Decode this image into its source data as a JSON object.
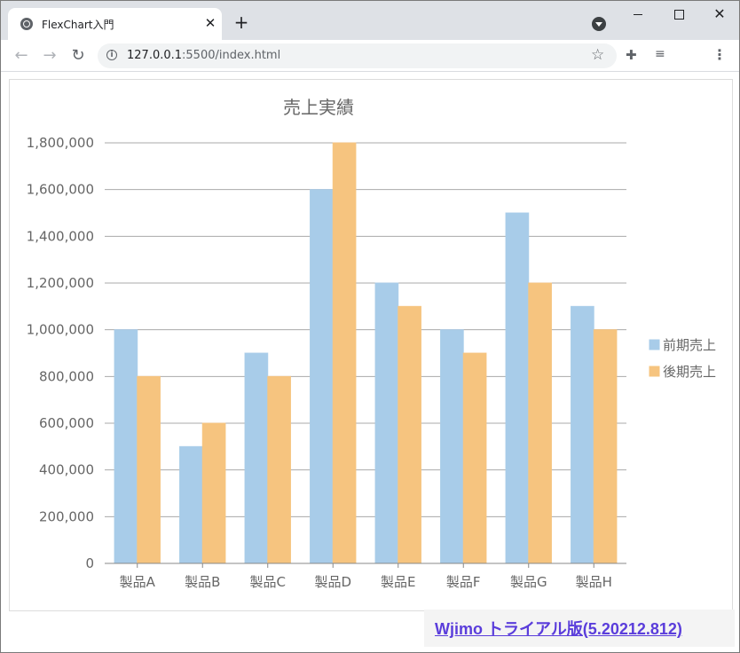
{
  "browser": {
    "tab_title": "FlexChart入門",
    "tab_close": "✕",
    "new_tab": "+",
    "url_host": "127.0.0.1",
    "url_rest": ":5500/index.html",
    "icons": [
      "globe-icon",
      "close-icon",
      "plus-icon",
      "tab-search-icon",
      "minimize-icon",
      "maximize-icon",
      "window-close-icon",
      "back-icon",
      "forward-icon",
      "reload-icon",
      "info-icon",
      "star-icon",
      "extensions-icon",
      "media-icon",
      "menu-icon"
    ]
  },
  "trial_link": "Wjimo トライアル版(5.20212.812)",
  "chart_data": {
    "type": "bar",
    "title": "売上実績",
    "categories": [
      "製品A",
      "製品B",
      "製品C",
      "製品D",
      "製品E",
      "製品F",
      "製品G",
      "製品H"
    ],
    "series": [
      {
        "name": "前期売上",
        "color": "#a8cce9",
        "values": [
          1000000,
          500000,
          900000,
          1600000,
          1200000,
          1000000,
          1500000,
          1100000
        ]
      },
      {
        "name": "後期売上",
        "color": "#f6c47f",
        "values": [
          800000,
          600000,
          800000,
          1800000,
          1100000,
          900000,
          1200000,
          1000000
        ]
      }
    ],
    "y_ticks": [
      "0",
      "200,000",
      "400,000",
      "600,000",
      "800,000",
      "1,000,000",
      "1,200,000",
      "1,400,000",
      "1,600,000",
      "1,800,000"
    ],
    "ylim": [
      0,
      1800000
    ],
    "ystep": 200000,
    "grid": true,
    "legend": "right"
  }
}
